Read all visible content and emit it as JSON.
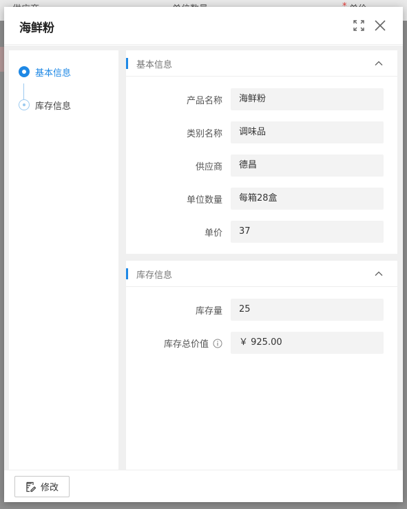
{
  "background": {
    "columns": [
      "供应商",
      "单位数量",
      "单价"
    ],
    "required_mark": "*"
  },
  "dialog": {
    "title": "海鲜粉",
    "maximize_icon": "expand-icon",
    "close_icon": "close-icon"
  },
  "nav": {
    "items": [
      {
        "label": "基本信息",
        "active": true
      },
      {
        "label": "库存信息",
        "active": false
      }
    ]
  },
  "sections": {
    "basic": {
      "title": "基本信息",
      "fields": [
        {
          "label": "产品名称",
          "value": "海鲜粉"
        },
        {
          "label": "类别名称",
          "value": "调味品"
        },
        {
          "label": "供应商",
          "value": "德昌"
        },
        {
          "label": "单位数量",
          "value": "每箱28盒"
        },
        {
          "label": "单价",
          "value": "37"
        }
      ]
    },
    "stock": {
      "title": "库存信息",
      "fields": [
        {
          "label": "库存量",
          "value": "25"
        },
        {
          "label": "库存总价值",
          "value": "￥ 925.00"
        }
      ]
    }
  },
  "footer": {
    "edit_label": "修改"
  },
  "colors": {
    "accent": "#1e88e5"
  }
}
